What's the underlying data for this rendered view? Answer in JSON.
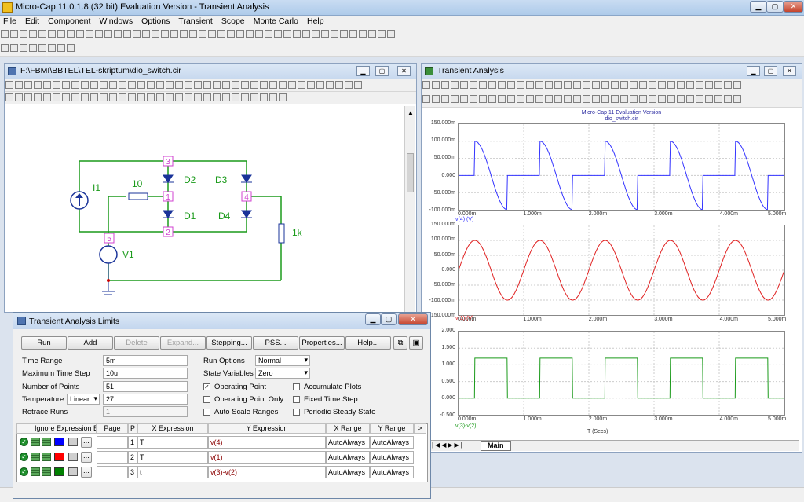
{
  "app": {
    "title": "Micro-Cap 11.0.1.8 (32 bit) Evaluation Version - Transient Analysis"
  },
  "menu": [
    "File",
    "Edit",
    "Component",
    "Windows",
    "Options",
    "Transient",
    "Scope",
    "Monte Carlo",
    "Help"
  ],
  "schematic": {
    "title": "F:\\FBMI\\BBTEL\\TEL-skriptum\\dio_switch.cir",
    "labels": {
      "i1": "I1",
      "r10": "10",
      "d2": "D2",
      "d3": "D3",
      "d1": "D1",
      "d4": "D4",
      "r1k": "1k",
      "v1": "V1",
      "n3": "3",
      "n1": "1",
      "n2": "2",
      "n4": "4",
      "n5": "5"
    }
  },
  "analysis": {
    "title": "Transient Analysis",
    "header1": "Micro-Cap 11 Evaluation Version",
    "header2": "dio_switch.cir",
    "tab": "Main",
    "xticks": [
      "0.000m",
      "1.000m",
      "2.000m",
      "3.000m",
      "4.000m",
      "5.000m"
    ],
    "plot1": {
      "yticks": [
        "150.000m",
        "100.000m",
        "50.000m",
        "0.000",
        "-50.000m",
        "-100.000m"
      ],
      "label": "v(4) (V)",
      "color": "#3333ff"
    },
    "plot2": {
      "yticks": [
        "150.000m",
        "100.000m",
        "50.000m",
        "0.000",
        "-50.000m",
        "-100.000m",
        "-150.000m"
      ],
      "label": "v(1) (V)",
      "color": "#e02020"
    },
    "plot3": {
      "yticks": [
        "2.000",
        "1.500",
        "1.000",
        "0.500",
        "0.000",
        "-0.500"
      ],
      "label": "v(3)-v(2)",
      "color": "#1a9a1a",
      "xlabel": "T (Secs)"
    }
  },
  "dialog": {
    "title": "Transient Analysis Limits",
    "buttons": {
      "run": "Run",
      "add": "Add",
      "delete": "Delete",
      "expand": "Expand...",
      "stepping": "Stepping...",
      "pss": "PSS...",
      "properties": "Properties...",
      "help": "Help..."
    },
    "fields": {
      "time_range_label": "Time Range",
      "time_range": "5m",
      "max_step_label": "Maximum Time Step",
      "max_step": "10u",
      "points_label": "Number of Points",
      "points": "51",
      "temp_label": "Temperature",
      "temp_mode": "Linear",
      "temp": "27",
      "retrace_label": "Retrace Runs",
      "retrace": "1"
    },
    "options": {
      "run_options_label": "Run Options",
      "run_options": "Normal",
      "state_vars_label": "State Variables",
      "state_vars": "Zero",
      "op_point": "Operating Point",
      "op_point_only": "Operating Point Only",
      "auto_scale": "Auto Scale Ranges",
      "accumulate": "Accumulate Plots",
      "fixed_step": "Fixed Time Step",
      "periodic": "Periodic Steady State"
    },
    "table": {
      "ignore": "Ignore Expression Err",
      "headers": [
        "Page",
        "P",
        "X Expression",
        "Y Expression",
        "X Range",
        "Y Range",
        ">"
      ],
      "rows": [
        {
          "p": "1",
          "x": "T",
          "y": "v(4)",
          "xr": "AutoAlways",
          "yr": "AutoAlways",
          "color": "#0000ff"
        },
        {
          "p": "2",
          "x": "T",
          "y": "v(1)",
          "xr": "AutoAlways",
          "yr": "AutoAlways",
          "color": "#ff0000"
        },
        {
          "p": "3",
          "x": "t",
          "y": "v(3)-v(2)",
          "xr": "AutoAlways",
          "yr": "AutoAlways",
          "color": "#008000"
        }
      ]
    }
  }
}
